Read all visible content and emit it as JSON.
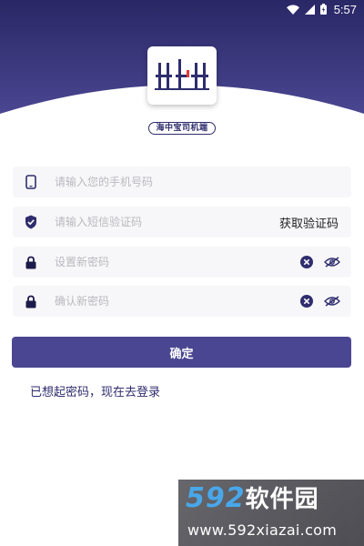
{
  "status_bar": {
    "time": "5:57",
    "icons": [
      "wifi-icon",
      "signal-icon",
      "battery-icon"
    ]
  },
  "app": {
    "name": "海中宝司机端",
    "logo": "hzb-logo"
  },
  "form": {
    "phone_placeholder": "请输入您的手机号码",
    "code_placeholder": "请输入短信验证码",
    "get_code_label": "获取验证码",
    "new_password_placeholder": "设置新密码",
    "confirm_password_placeholder": "确认新密码"
  },
  "actions": {
    "confirm_label": "确定",
    "login_link": "已想起密码，现在去登录"
  },
  "watermark": {
    "digits": "592",
    "text": "软件园",
    "url": "www.592xiazai.com"
  },
  "colors": {
    "header_top": "#2a2766",
    "header_bottom": "#4a4691",
    "accent": "#4a4691",
    "icon_dark": "#2f2d6e"
  }
}
